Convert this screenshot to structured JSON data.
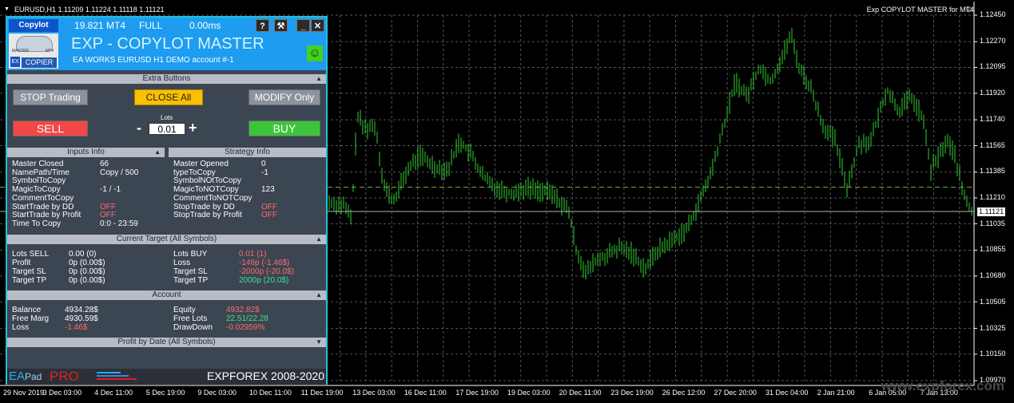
{
  "chart": {
    "symbol_info": "EURUSD,H1  1.11209 1.11224 1.11118 1.11121",
    "ea_label": "Exp COPYLOT MASTER for MT4",
    "smiley": "☺",
    "current_price": "1.11121",
    "watermark": "www.expforex.com",
    "price_axis": [
      "1.12450",
      "1.12270",
      "1.12095",
      "1.11920",
      "1.11740",
      "1.11565",
      "1.11385",
      "1.11210",
      "1.11035",
      "1.10855",
      "1.10680",
      "1.10505",
      "1.10325",
      "1.10150",
      "1.09970"
    ],
    "date_axis": [
      "29 Nov 2019",
      "3 Dec 03:00",
      "4 Dec 11:00",
      "5 Dec 19:00",
      "9 Dec 03:00",
      "10 Dec 11:00",
      "11 Dec 19:00",
      "13 Dec 03:00",
      "16 Dec 11:00",
      "17 Dec 19:00",
      "19 Dec 03:00",
      "20 Dec 11:00",
      "23 Dec 19:00",
      "26 Dec 12:00",
      "27 Dec 20:00",
      "31 Dec 04:00",
      "2 Jan 21:00",
      "6 Jan 05:00",
      "7 Jan 13:00"
    ],
    "colors": {
      "candles": "#33d133",
      "grid": "#555555",
      "panel_border": "#22c0d8"
    }
  },
  "panel": {
    "tab_label": "Copylot",
    "version": "19.821 MT4",
    "mode": "FULL",
    "latency": "0.00ms",
    "help_btn": "?",
    "tools_btn": "⚒",
    "minimize_btn": "_",
    "close_btn": "✕",
    "logo": {
      "master": "MASTER",
      "mt4": "MT4",
      "ex": "EX",
      "copier": "COPIER"
    },
    "title": "EXP - COPYLOT MASTER",
    "subtitle": "EA WORKS EURUSD  H1 DEMO account   #-1",
    "status_icon": "☺",
    "extra_buttons": {
      "title": "Extra Buttons",
      "stop_trading": "STOP Trading",
      "close_all": "CLOSE All",
      "modify_only": "MODIFY Only",
      "sell": "SELL",
      "buy": "BUY",
      "lots_label": "Lots",
      "lots_value": "0.01",
      "minus": "-",
      "plus": "+"
    },
    "inputs_info": {
      "title": "Inputs Info",
      "rows": [
        {
          "label": "Master Closed",
          "value": "66"
        },
        {
          "label": "NamePath/Time",
          "value": "Copy / 500"
        },
        {
          "label": "SymbolToCopy",
          "value": ""
        },
        {
          "label": "MagicToCopy",
          "value": "-1 / -1"
        },
        {
          "label": "CommentToCopy",
          "value": ""
        },
        {
          "label": "StartTrade by DD",
          "value": "OFF"
        },
        {
          "label": "StartTrade by Profit",
          "value": "OFF"
        },
        {
          "label": "Time To Copy",
          "value": "0:0 - 23:59"
        }
      ]
    },
    "strategy_info": {
      "title": "Strategy Info",
      "rows": [
        {
          "label": "Master Opened",
          "value": "0"
        },
        {
          "label": "typeToCopy",
          "value": "-1"
        },
        {
          "label": "SymbolNOtToCopy",
          "value": ""
        },
        {
          "label": "MagicToNOTCopy",
          "value": "123"
        },
        {
          "label": "CommentToNOTCopy",
          "value": ""
        },
        {
          "label": "StopTrade by DD",
          "value": "OFF"
        },
        {
          "label": "StopTrade by Profit",
          "value": "OFF"
        }
      ]
    },
    "current_target": {
      "title": "Current Target (All Symbols)",
      "left": [
        {
          "label": "Lots SELL",
          "value": "0.00 (0)"
        },
        {
          "label": "Profit",
          "value": "0p (0.00$)"
        },
        {
          "label": "Target SL",
          "value": "0p (0.00$)"
        },
        {
          "label": "Target TP",
          "value": "0p (0.00$)"
        }
      ],
      "right": [
        {
          "label": "Lots BUY",
          "value": "0.01 (1)"
        },
        {
          "label": "Loss",
          "value": "-146p (-1.46$)"
        },
        {
          "label": "Target SL",
          "value": "-2000p (-20.0$)"
        },
        {
          "label": "Target TP",
          "value": "2000p (20.0$)"
        }
      ]
    },
    "account": {
      "title": "Account",
      "left": [
        {
          "label": "Balance",
          "value": "4934.28$"
        },
        {
          "label": "Free Marg",
          "value": "4930.59$"
        },
        {
          "label": "Loss",
          "value": "-1.46$"
        }
      ],
      "right": [
        {
          "label": "Equity",
          "value": "4932.82$"
        },
        {
          "label": "Free Lots",
          "value": "22.51/22.28"
        },
        {
          "label": "DrawDown",
          "value": "-0.02959%"
        }
      ]
    },
    "profit_by_date": {
      "title": "Profit by Date (All Symbols)"
    },
    "footer": {
      "ea": "EA",
      "pad": "Pad",
      "pro": "PRO",
      "copyright": "EXPFOREX 2008-2020"
    }
  }
}
